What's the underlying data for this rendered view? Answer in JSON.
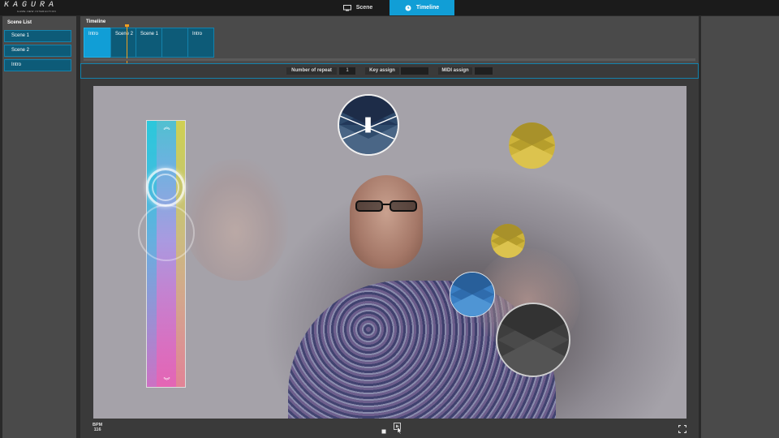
{
  "app": {
    "logo_text": "KAGURA",
    "logo_sub": "GAME·NEW·INTERACTION"
  },
  "tabs": [
    {
      "label": "Scene",
      "icon": "monitor-icon",
      "active": false
    },
    {
      "label": "Timeline",
      "icon": "clock-icon",
      "active": true
    }
  ],
  "scene_list": {
    "title": "Scene List",
    "items": [
      {
        "label": "Scene 1"
      },
      {
        "label": "Scene 2"
      },
      {
        "label": "Intro"
      }
    ]
  },
  "timeline": {
    "title": "Timeline",
    "clips": [
      {
        "label": "Intro",
        "active": true
      },
      {
        "label": "Scene 2",
        "active": false
      },
      {
        "label": "Scene 1",
        "active": false
      },
      {
        "label": "",
        "active": false
      },
      {
        "label": "Intro",
        "active": false
      }
    ]
  },
  "props": {
    "repeat_label": "Number of repeat",
    "repeat_value": "1",
    "key_label": "Key assign",
    "key_value": "",
    "midi_label": "MIDI assign",
    "midi_value": ""
  },
  "player": {
    "bpm_label": "BPM",
    "bpm_value": "116"
  },
  "colors": {
    "accent": "#119ed6",
    "clip": "#0d5b78",
    "playhead": "#f0a020",
    "panel": "#4a4a4a"
  }
}
